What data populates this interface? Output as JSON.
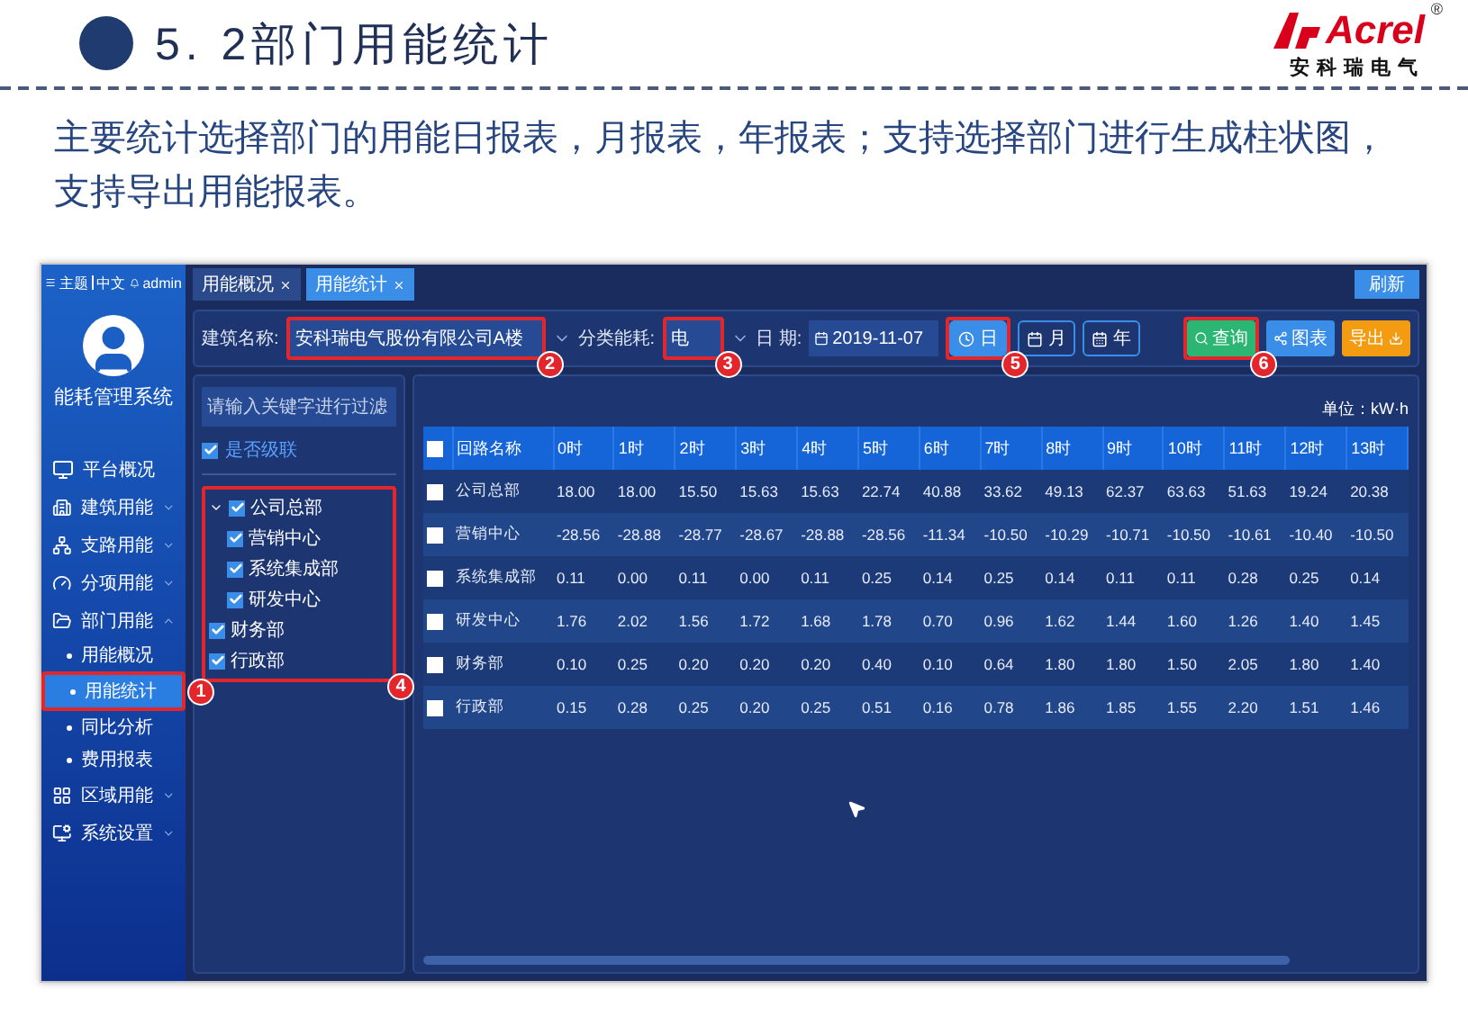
{
  "page": {
    "section_title": "5. 2部门用能统计",
    "logo": {
      "brand": "Acrel",
      "registered": "®",
      "tagline": "安科瑞电气"
    },
    "description": "主要统计选择部门的用能日报表，月报表，年报表；支持选择部门进行生成柱状图，支持导出用能报表。"
  },
  "app": {
    "topbar": {
      "theme": "主题",
      "language": "中文",
      "user": "admin"
    },
    "system_name": "能耗管理系统",
    "nav": [
      {
        "label": "平台概况",
        "kind": "link"
      },
      {
        "label": "建筑用能",
        "kind": "group",
        "expanded": false
      },
      {
        "label": "支路用能",
        "kind": "group",
        "expanded": false
      },
      {
        "label": "分项用能",
        "kind": "group",
        "expanded": false
      },
      {
        "label": "部门用能",
        "kind": "group",
        "expanded": true,
        "children": [
          {
            "label": "用能概况",
            "selected": false
          },
          {
            "label": "用能统计",
            "selected": true,
            "callout": "1"
          },
          {
            "label": "同比分析",
            "selected": false
          },
          {
            "label": "费用报表",
            "selected": false
          }
        ]
      },
      {
        "label": "区域用能",
        "kind": "group",
        "expanded": false
      },
      {
        "label": "系统设置",
        "kind": "group",
        "expanded": false
      }
    ],
    "tabs": [
      {
        "label": "用能概况",
        "selected": false
      },
      {
        "label": "用能统计",
        "selected": true
      }
    ],
    "refresh": "刷新",
    "filters": {
      "building_label": "建筑名称:",
      "building_value": "安科瑞电气股份有限公司A楼",
      "building_callout": "2",
      "category_label": "分类能耗:",
      "category_value": "电",
      "category_callout": "3",
      "date_label": "日 期:",
      "date_value": "2019-11-07",
      "periods": [
        {
          "label": "日",
          "selected": true
        },
        {
          "label": "月",
          "selected": false
        },
        {
          "label": "年",
          "selected": false
        }
      ],
      "periods_callout": "5",
      "actions": [
        {
          "label": "查询",
          "kind": "query",
          "callout": "6"
        },
        {
          "label": "图表",
          "kind": "chart"
        },
        {
          "label": "导出",
          "kind": "export"
        }
      ]
    },
    "tree": {
      "placeholder": "请输入关键字进行过滤",
      "cascade": {
        "label": "是否级联",
        "checked": true
      },
      "callout": "4",
      "nodes": [
        {
          "label": "公司总部",
          "checked": true,
          "expanded": true,
          "children": [
            {
              "label": "营销中心",
              "checked": true
            },
            {
              "label": "系统集成部",
              "checked": true
            },
            {
              "label": "研发中心",
              "checked": true
            }
          ]
        },
        {
          "label": "财务部",
          "checked": true
        },
        {
          "label": "行政部",
          "checked": true
        }
      ]
    },
    "table": {
      "unit": "单位：kW·h",
      "all_selected": false,
      "columns": [
        "回路名称",
        "0时",
        "1时",
        "2时",
        "3时",
        "4时",
        "5时",
        "6时",
        "7时",
        "8时",
        "9时",
        "10时",
        "11时",
        "12时",
        "13时"
      ],
      "rows": [
        {
          "selected": false,
          "cells": [
            "公司总部",
            "18.00",
            "18.00",
            "15.50",
            "15.63",
            "15.63",
            "22.74",
            "40.88",
            "33.62",
            "49.13",
            "62.37",
            "63.63",
            "51.63",
            "19.24",
            "20.38"
          ]
        },
        {
          "selected": false,
          "cells": [
            "营销中心",
            "-28.56",
            "-28.88",
            "-28.77",
            "-28.67",
            "-28.88",
            "-28.56",
            "-11.34",
            "-10.50",
            "-10.29",
            "-10.71",
            "-10.50",
            "-10.61",
            "-10.40",
            "-10.50"
          ]
        },
        {
          "selected": false,
          "cells": [
            "系统集成部",
            "0.11",
            "0.00",
            "0.11",
            "0.00",
            "0.11",
            "0.25",
            "0.14",
            "0.25",
            "0.14",
            "0.11",
            "0.11",
            "0.28",
            "0.25",
            "0.14"
          ]
        },
        {
          "selected": false,
          "cells": [
            "研发中心",
            "1.76",
            "2.02",
            "1.56",
            "1.72",
            "1.68",
            "1.78",
            "0.70",
            "0.96",
            "1.62",
            "1.44",
            "1.60",
            "1.26",
            "1.40",
            "1.45"
          ]
        },
        {
          "selected": false,
          "cells": [
            "财务部",
            "0.10",
            "0.25",
            "0.20",
            "0.20",
            "0.20",
            "0.40",
            "0.10",
            "0.64",
            "1.80",
            "1.80",
            "1.50",
            "2.05",
            "1.80",
            "1.40"
          ]
        },
        {
          "selected": false,
          "cells": [
            "行政部",
            "0.15",
            "0.28",
            "0.25",
            "0.20",
            "0.25",
            "0.51",
            "0.16",
            "0.78",
            "1.86",
            "1.85",
            "1.55",
            "2.20",
            "1.51",
            "1.46"
          ]
        }
      ]
    }
  }
}
